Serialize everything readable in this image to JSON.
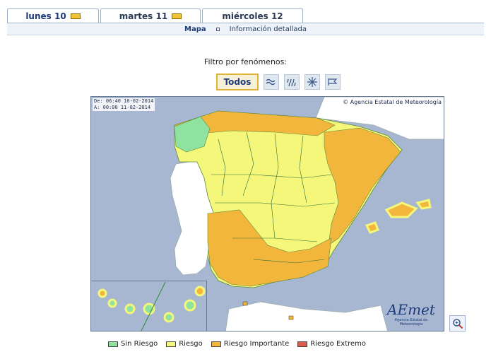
{
  "tabs": [
    {
      "label": "lunes 10",
      "active": true,
      "risk_color": "#f0c436"
    },
    {
      "label": "martes 11",
      "active": false,
      "risk_color": "#f0c436"
    },
    {
      "label": "miércoles 12",
      "active": false
    }
  ],
  "subnav": {
    "map": "Mapa",
    "info": "Información detallada"
  },
  "filter": {
    "title": "Filtro por fenómenos:",
    "all_label": "Todos",
    "buttons": [
      "wind-icon",
      "rain-icon",
      "snow-icon",
      "coastal-icon"
    ]
  },
  "map": {
    "validity_from": "De:  06:40 10-02-2014",
    "validity_to": "A:   00:00 11-02-2014",
    "agency": "© Agencia Estatal de Meteorología",
    "logo_mark": "AEmet",
    "logo_sub": "Agencia Estatal de Meteorología"
  },
  "legend": [
    {
      "label": "Sin Riesgo",
      "color": "#8fe2a0"
    },
    {
      "label": "Riesgo",
      "color": "#f4f77a"
    },
    {
      "label": "Riesgo Importante",
      "color": "#f3b63c"
    },
    {
      "label": "Riesgo Extremo",
      "color": "#e05a4c"
    }
  ]
}
